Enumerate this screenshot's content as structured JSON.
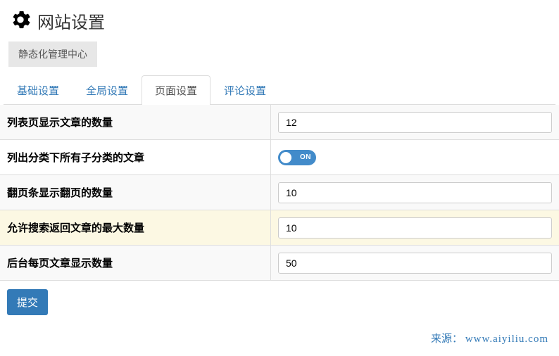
{
  "header": {
    "title": "网站设置"
  },
  "breadcrumb": {
    "label": "静态化管理中心"
  },
  "tabs": [
    {
      "label": "基础设置",
      "active": false
    },
    {
      "label": "全局设置",
      "active": false
    },
    {
      "label": "页面设置",
      "active": true
    },
    {
      "label": "评论设置",
      "active": false
    }
  ],
  "settings": [
    {
      "label": "列表页显示文章的数量",
      "type": "text",
      "value": "12",
      "rowStyle": "even"
    },
    {
      "label": "列出分类下所有子分类的文章",
      "type": "toggle",
      "value": "ON",
      "rowStyle": ""
    },
    {
      "label": "翻页条显示翻页的数量",
      "type": "text",
      "value": "10",
      "rowStyle": "even"
    },
    {
      "label": "允许搜索返回文章的最大数量",
      "type": "text",
      "value": "10",
      "rowStyle": "highlight"
    },
    {
      "label": "后台每页文章显示数量",
      "type": "text",
      "value": "50",
      "rowStyle": "even"
    }
  ],
  "submit": {
    "label": "提交"
  },
  "footer": {
    "source_prefix": "来源：",
    "source_url": "www.aiyiliu.com"
  }
}
